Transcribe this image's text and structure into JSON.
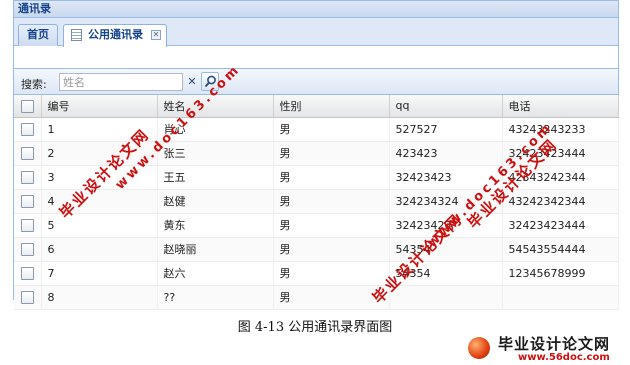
{
  "window": {
    "title": "通讯录"
  },
  "tabs": [
    {
      "label": "首页"
    },
    {
      "label": "公用通讯录"
    }
  ],
  "search": {
    "label": "搜索:",
    "placeholder": "姓名",
    "value": ""
  },
  "grid": {
    "columns": [
      "编号",
      "姓名",
      "性别",
      "qq",
      "电话"
    ],
    "rows": [
      {
        "id": "1",
        "name": "肖心",
        "gender": "男",
        "qq": "527527",
        "phone": "43243243233"
      },
      {
        "id": "2",
        "name": "张三",
        "gender": "男",
        "qq": "423423",
        "phone": "32423423444"
      },
      {
        "id": "3",
        "name": "王五",
        "gender": "男",
        "qq": "32423423",
        "phone": "42343242344"
      },
      {
        "id": "4",
        "name": "赵健",
        "gender": "男",
        "qq": "324234324",
        "phone": "43242342344"
      },
      {
        "id": "5",
        "name": "黄东",
        "gender": "男",
        "qq": "32423423",
        "phone": "32423423444"
      },
      {
        "id": "6",
        "name": "赵晓丽",
        "gender": "男",
        "qq": "54354",
        "phone": "54543554444"
      },
      {
        "id": "7",
        "name": "赵六",
        "gender": "男",
        "qq": "54354",
        "phone": "12345678999"
      },
      {
        "id": "8",
        "name": "??",
        "gender": "男",
        "qq": "",
        "phone": ""
      }
    ]
  },
  "caption": "图 4-13   公用通讯录界面图",
  "watermarks": {
    "cn": "毕业设计论文网",
    "url": "www.doc163.com"
  },
  "logo": {
    "name": "毕业设计论文网",
    "site": "www.56doc.com"
  },
  "colors": {
    "header_text": "#15428b",
    "border": "#99bbe8",
    "watermark": "#cc1111"
  }
}
